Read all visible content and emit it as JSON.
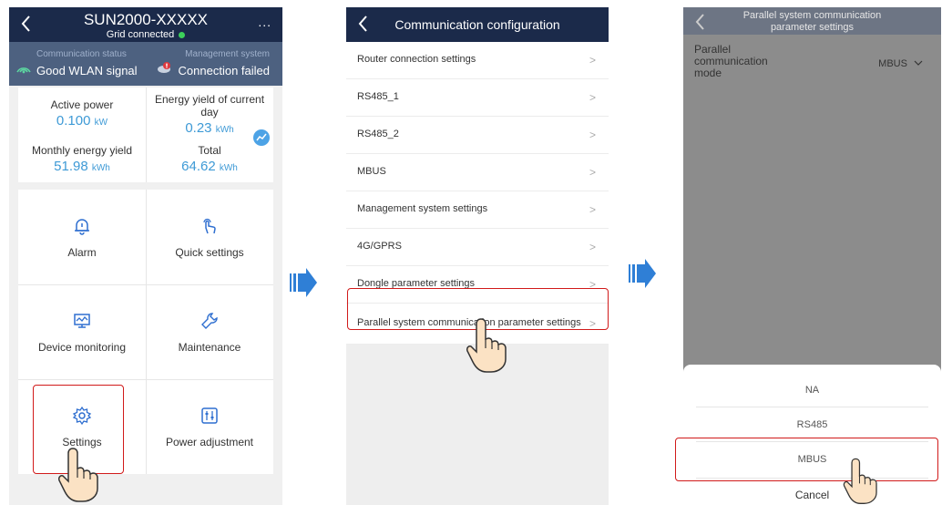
{
  "screen1": {
    "title": "SUN2000-XXXXX",
    "subtitle": "Grid connected",
    "more": "...",
    "comm_status": {
      "label": "Communication status",
      "value": "Good WLAN signal"
    },
    "mgmt_system": {
      "label": "Management system",
      "value": "Connection failed"
    },
    "energy": {
      "active_power": {
        "label": "Active power",
        "value": "0.100",
        "unit": "kW"
      },
      "daily_yield": {
        "label": "Energy yield of current day",
        "value": "0.23",
        "unit": "kWh"
      },
      "monthly_yield": {
        "label": "Monthly energy yield",
        "value": "51.98",
        "unit": "kWh"
      },
      "total": {
        "label": "Total",
        "value": "64.62",
        "unit": "kWh"
      }
    },
    "menu": {
      "alarm": "Alarm",
      "quick_settings": "Quick settings",
      "device_monitoring": "Device monitoring",
      "maintenance": "Maintenance",
      "settings": "Settings",
      "power_adjustment": "Power adjustment"
    }
  },
  "screen2": {
    "title": "Communication configuration",
    "items": [
      "Router connection settings",
      "RS485_1",
      "RS485_2",
      "MBUS",
      "Management system settings",
      "4G/GPRS",
      "Dongle parameter settings",
      "Parallel system communication parameter settings"
    ],
    "chevron": ">"
  },
  "screen3": {
    "title_line1": "Parallel system communication",
    "title_line2": "parameter settings",
    "param_label": "Parallel communication mode",
    "param_value": "MBUS",
    "options": [
      "NA",
      "RS485",
      "MBUS"
    ],
    "cancel": "Cancel"
  },
  "colors": {
    "header": "#1b2a4a",
    "status_bar": "#4d6180",
    "value_blue": "#3e9ad6",
    "highlight": "#d11a1a",
    "arrow_blue": "#2f7fd6"
  }
}
